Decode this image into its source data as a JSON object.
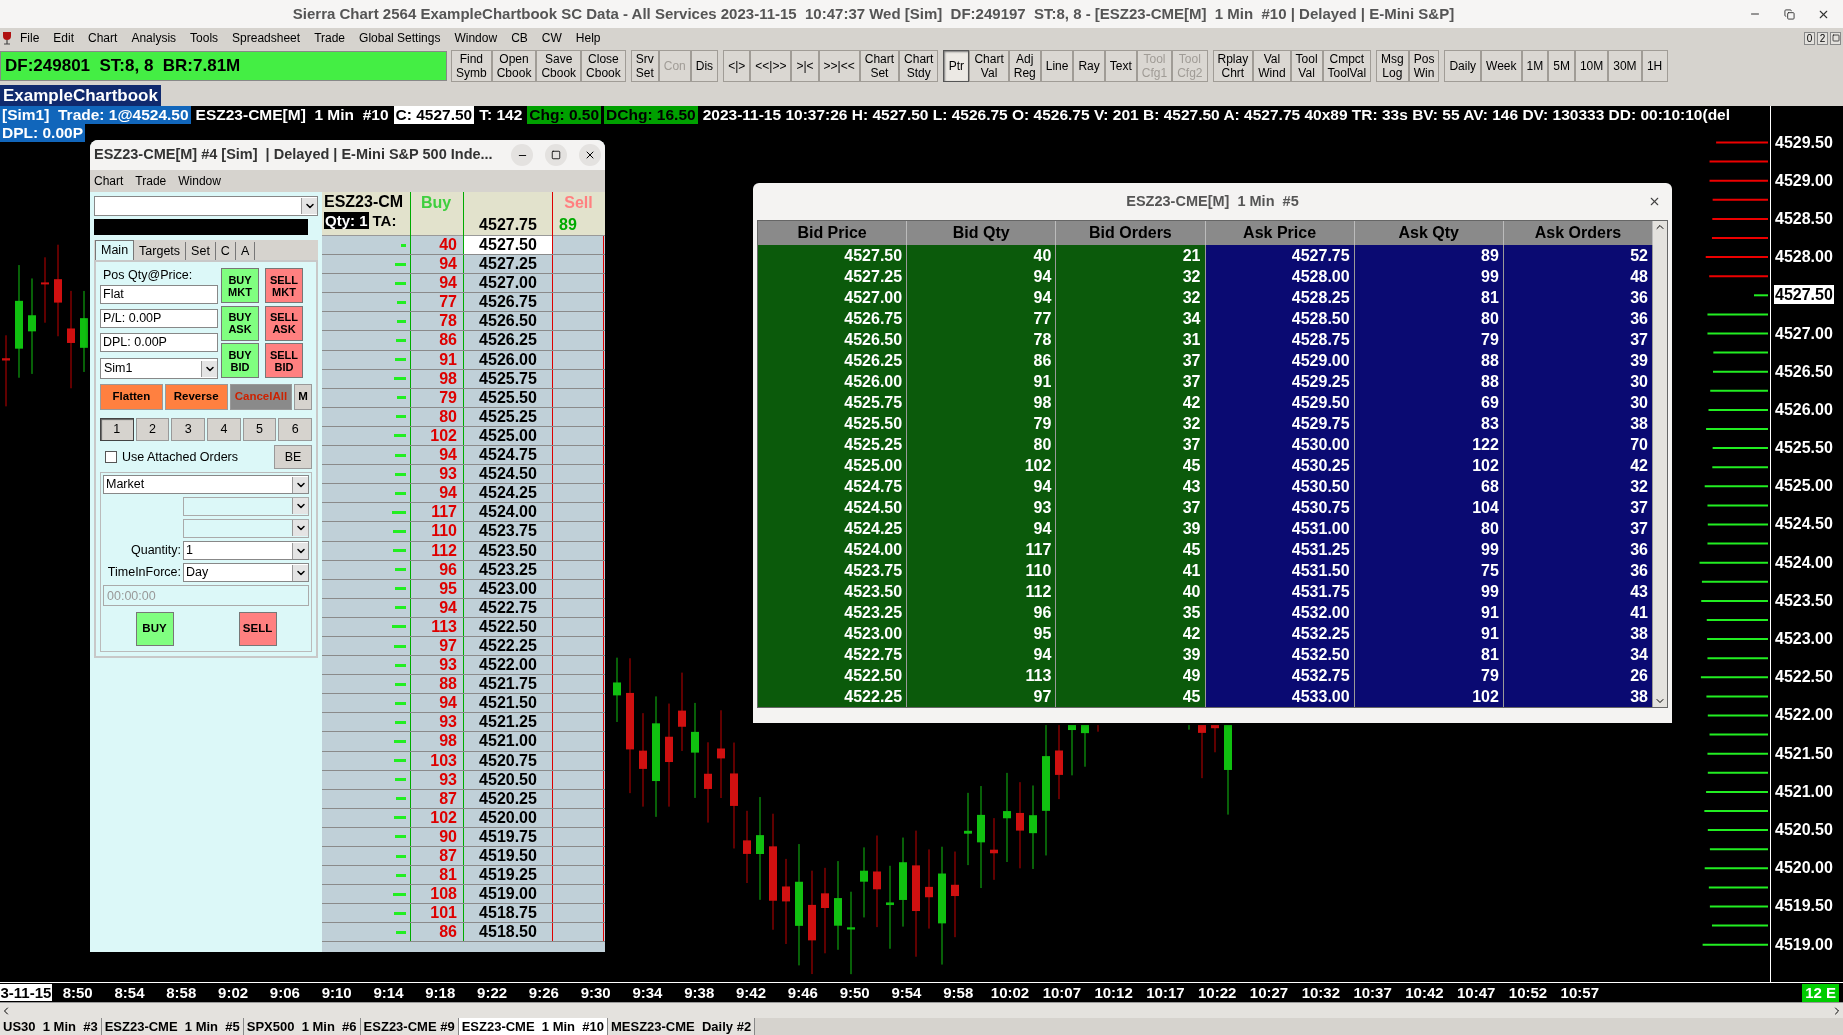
{
  "window": {
    "title": "Sierra Chart 2564 ExampleChartbook SC Data - All Services 2023-11-15  10:47:37 Wed [Sim]  DF:249197  ST:8, 8 - [ESZ23-CME[M]  1 Min  #10 | Delayed | E-Mini S&P]"
  },
  "menu": [
    "File",
    "Edit",
    "Chart",
    "Analysis",
    "Tools",
    "Spreadsheet",
    "Trade",
    "Global Settings",
    "Window",
    "CB",
    "CW",
    "Help"
  ],
  "corner_buttons": [
    "0",
    "2"
  ],
  "status": "DF:249801  ST:8, 8  BR:7.81M",
  "toolbar": [
    [
      {
        "lines": [
          "Find",
          "Symb"
        ],
        "disabled": false,
        "pressed": false
      },
      {
        "lines": [
          "Open",
          "Cbook"
        ],
        "disabled": false,
        "pressed": false
      },
      {
        "lines": [
          "Save",
          "Cbook"
        ],
        "disabled": false,
        "pressed": false
      },
      {
        "lines": [
          "Close",
          "Cbook"
        ],
        "disabled": false,
        "pressed": false
      }
    ],
    [
      {
        "lines": [
          "Srv",
          "Set"
        ],
        "disabled": false,
        "pressed": false
      },
      {
        "lines": [
          "Con"
        ],
        "disabled": true,
        "pressed": false
      },
      {
        "lines": [
          "Dis"
        ],
        "disabled": false,
        "pressed": false
      }
    ],
    [
      {
        "lines": [
          "<|>"
        ],
        "disabled": false,
        "pressed": false
      },
      {
        "lines": [
          "<<|>>"
        ],
        "disabled": false,
        "pressed": false
      },
      {
        "lines": [
          ">|<"
        ],
        "disabled": false,
        "pressed": false
      },
      {
        "lines": [
          ">>|<<"
        ],
        "disabled": false,
        "pressed": false
      },
      {
        "lines": [
          "Chart",
          "Set"
        ],
        "disabled": false,
        "pressed": false
      },
      {
        "lines": [
          "Chart",
          "Stdy"
        ],
        "disabled": false,
        "pressed": false
      }
    ],
    [
      {
        "lines": [
          "Ptr"
        ],
        "disabled": false,
        "pressed": true
      },
      {
        "lines": [
          "Chart",
          "Val"
        ],
        "disabled": false,
        "pressed": false
      },
      {
        "lines": [
          "Adj",
          "Reg"
        ],
        "disabled": false,
        "pressed": false
      },
      {
        "lines": [
          "Line"
        ],
        "disabled": false,
        "pressed": false
      },
      {
        "lines": [
          "Ray"
        ],
        "disabled": false,
        "pressed": false
      },
      {
        "lines": [
          "Text"
        ],
        "disabled": false,
        "pressed": false
      },
      {
        "lines": [
          "Tool",
          "Cfg1"
        ],
        "disabled": true,
        "pressed": false
      },
      {
        "lines": [
          "Tool",
          "Cfg2"
        ],
        "disabled": true,
        "pressed": false
      }
    ],
    [
      {
        "lines": [
          "Rplay",
          "Chrt"
        ],
        "disabled": false,
        "pressed": false
      },
      {
        "lines": [
          "Val",
          "Wind"
        ],
        "disabled": false,
        "pressed": false
      },
      {
        "lines": [
          "Tool",
          "Val"
        ],
        "disabled": false,
        "pressed": false
      },
      {
        "lines": [
          "Cmpct",
          "ToolVal"
        ],
        "disabled": false,
        "pressed": false
      }
    ],
    [
      {
        "lines": [
          "Msg",
          "Log"
        ],
        "disabled": false,
        "pressed": false
      },
      {
        "lines": [
          "Pos",
          "Win"
        ],
        "disabled": false,
        "pressed": false
      }
    ],
    [
      {
        "lines": [
          "Daily"
        ],
        "disabled": false,
        "pressed": false
      },
      {
        "lines": [
          "Week"
        ],
        "disabled": false,
        "pressed": false
      },
      {
        "lines": [
          "1M"
        ],
        "disabled": false,
        "pressed": false
      },
      {
        "lines": [
          "5M"
        ],
        "disabled": false,
        "pressed": false
      },
      {
        "lines": [
          "10M"
        ],
        "disabled": false,
        "pressed": false
      },
      {
        "lines": [
          "30M"
        ],
        "disabled": false,
        "pressed": false
      },
      {
        "lines": [
          "1H"
        ],
        "disabled": false,
        "pressed": false
      }
    ]
  ],
  "chartbook_tab": "ExampleChartbook",
  "info_line": [
    {
      "text": "[Sim1]  Trade: 1@4524.50",
      "kind": "account"
    },
    {
      "text": "ESZ23-CME[M]  1 Min  #10",
      "kind": "plain"
    },
    {
      "text": "C: 4527.50",
      "kind": "inverse"
    },
    {
      "text": "T: 142",
      "kind": "plain"
    },
    {
      "text": "Chg: 0.50",
      "kind": "positive"
    },
    {
      "text": "DChg: 16.50",
      "kind": "positive"
    },
    {
      "text": "2023-11-15 10:37:26 H: 4527.50 L: 4526.75 O: 4526.75 V: 201 B: 4527.50 A: 4527.75 40x89 TR: 33s BV: 55 AV: 146 DV: 130333 DD: 00:10:10(del",
      "kind": "plain"
    }
  ],
  "info_line_2": [
    {
      "text": "DPL: 0.00P",
      "kind": "account"
    }
  ],
  "price_axis": [
    {
      "text": "4529.50",
      "highlighted": false
    },
    {
      "text": "4529.00",
      "highlighted": false
    },
    {
      "text": "4528.50",
      "highlighted": false
    },
    {
      "text": "4528.00",
      "highlighted": false
    },
    {
      "text": "4527.50",
      "highlighted": true
    },
    {
      "text": "4527.00",
      "highlighted": false
    },
    {
      "text": "4526.50",
      "highlighted": false
    },
    {
      "text": "4526.00",
      "highlighted": false
    },
    {
      "text": "4525.50",
      "highlighted": false
    },
    {
      "text": "4525.00",
      "highlighted": false
    },
    {
      "text": "4524.50",
      "highlighted": false
    },
    {
      "text": "4524.00",
      "highlighted": false
    },
    {
      "text": "4523.50",
      "highlighted": false
    },
    {
      "text": "4523.00",
      "highlighted": false
    },
    {
      "text": "4522.50",
      "highlighted": false
    },
    {
      "text": "4522.00",
      "highlighted": false
    },
    {
      "text": "4521.50",
      "highlighted": false
    },
    {
      "text": "4521.00",
      "highlighted": false
    },
    {
      "text": "4520.50",
      "highlighted": false
    },
    {
      "text": "4520.00",
      "highlighted": false
    },
    {
      "text": "4519.50",
      "highlighted": false
    },
    {
      "text": "4519.00",
      "highlighted": false
    }
  ],
  "time_axis": [
    {
      "text": "3-11-15",
      "highlighted": true
    },
    {
      "text": "8:50",
      "highlighted": false
    },
    {
      "text": "8:54",
      "highlighted": false
    },
    {
      "text": "8:58",
      "highlighted": false
    },
    {
      "text": "9:02",
      "highlighted": false
    },
    {
      "text": "9:06",
      "highlighted": false
    },
    {
      "text": "9:10",
      "highlighted": false
    },
    {
      "text": "9:14",
      "highlighted": false
    },
    {
      "text": "9:18",
      "highlighted": false
    },
    {
      "text": "9:22",
      "highlighted": false
    },
    {
      "text": "9:26",
      "highlighted": false
    },
    {
      "text": "9:30",
      "highlighted": false
    },
    {
      "text": "9:34",
      "highlighted": false
    },
    {
      "text": "9:38",
      "highlighted": false
    },
    {
      "text": "9:42",
      "highlighted": false
    },
    {
      "text": "9:46",
      "highlighted": false
    },
    {
      "text": "9:50",
      "highlighted": false
    },
    {
      "text": "9:54",
      "highlighted": false
    },
    {
      "text": "9:58",
      "highlighted": false
    },
    {
      "text": "10:02",
      "highlighted": false
    },
    {
      "text": "10:07",
      "highlighted": false
    },
    {
      "text": "10:12",
      "highlighted": false
    },
    {
      "text": "10:17",
      "highlighted": false
    },
    {
      "text": "10:22",
      "highlighted": false
    },
    {
      "text": "10:27",
      "highlighted": false
    },
    {
      "text": "10:32",
      "highlighted": false
    },
    {
      "text": "10:37",
      "highlighted": false
    },
    {
      "text": "10:42",
      "highlighted": false
    },
    {
      "text": "10:47",
      "highlighted": false
    },
    {
      "text": "10:52",
      "highlighted": false
    },
    {
      "text": "10:57",
      "highlighted": false
    }
  ],
  "axis_badge": "12 E",
  "chartbook_tabs": [
    {
      "label": "US30  1 Min  #3",
      "selected": false
    },
    {
      "label": "ESZ23-CME  1 Min  #5",
      "selected": false
    },
    {
      "label": "SPX500  1 Min  #6",
      "selected": false
    },
    {
      "label": "ESZ23-CME #9",
      "selected": false
    },
    {
      "label": "ESZ23-CME  1 Min  #10",
      "selected": true
    },
    {
      "label": "MESZ23-CME  Daily #2",
      "selected": false
    }
  ],
  "trade_window": {
    "title": "ESZ23-CME[M] #4 [Sim]  | Delayed | E-Mini S&P 500 Inde...",
    "menu": [
      "Chart",
      "Trade",
      "Window"
    ],
    "tabs": [
      {
        "label": "Main",
        "selected": true
      },
      {
        "label": "Targets",
        "selected": false
      },
      {
        "label": "Set",
        "selected": false
      },
      {
        "label": "C",
        "selected": false
      },
      {
        "label": "A",
        "selected": false
      }
    ],
    "position_label": "Pos Qty@Price:",
    "position": "Flat",
    "pl": "P/L: 0.00P",
    "dpl": "DPL: 0.00P",
    "account": "Sim1",
    "order_buttons": [
      {
        "lines": [
          "BUY",
          "MKT"
        ],
        "kind": "buy"
      },
      {
        "lines": [
          "SELL",
          "MKT"
        ],
        "kind": "sell"
      },
      {
        "lines": [
          "BUY",
          "ASK"
        ],
        "kind": "buy"
      },
      {
        "lines": [
          "SELL",
          "ASK"
        ],
        "kind": "sell"
      },
      {
        "lines": [
          "BUY",
          "BID"
        ],
        "kind": "buy"
      },
      {
        "lines": [
          "SELL",
          "BID"
        ],
        "kind": "sell"
      }
    ],
    "action_buttons": [
      {
        "label": "Flatten",
        "kind": "orange"
      },
      {
        "label": "Reverse",
        "kind": "orange"
      },
      {
        "label": "CancelAll",
        "kind": "cancel"
      },
      {
        "label": "M",
        "kind": "plain"
      }
    ],
    "qty_presets": [
      {
        "label": "1",
        "selected": true
      },
      {
        "label": "2",
        "selected": false
      },
      {
        "label": "3",
        "selected": false
      },
      {
        "label": "4",
        "selected": false
      },
      {
        "label": "5",
        "selected": false
      },
      {
        "label": "6",
        "selected": false
      }
    ],
    "attached_orders": {
      "label": "Use Attached Orders",
      "checked": false
    },
    "be_button": "BE",
    "order_type": "Market",
    "quantity_label": "Quantity:",
    "quantity": "1",
    "tif_label": "TimeInForce:",
    "tif": "Day",
    "time_placeholder": "00:00:00",
    "buy": "BUY",
    "sell": "SELL"
  },
  "dom": {
    "symbol": "ESZ23-CM",
    "qty": "Qty: 1",
    "ta": "TA:",
    "buy_header": "Buy",
    "sell_header": "Sell",
    "ask_price": "4527.75",
    "ask_qty": "89",
    "rows": [
      {
        "bid": "40",
        "price": "4527.50",
        "highlighted": true
      },
      {
        "bid": "94",
        "price": "4527.25",
        "highlighted": false
      },
      {
        "bid": "94",
        "price": "4527.00",
        "highlighted": false
      },
      {
        "bid": "77",
        "price": "4526.75",
        "highlighted": false
      },
      {
        "bid": "78",
        "price": "4526.50",
        "highlighted": false
      },
      {
        "bid": "86",
        "price": "4526.25",
        "highlighted": false
      },
      {
        "bid": "91",
        "price": "4526.00",
        "highlighted": false
      },
      {
        "bid": "98",
        "price": "4525.75",
        "highlighted": false
      },
      {
        "bid": "79",
        "price": "4525.50",
        "highlighted": false
      },
      {
        "bid": "80",
        "price": "4525.25",
        "highlighted": false
      },
      {
        "bid": "102",
        "price": "4525.00",
        "highlighted": false
      },
      {
        "bid": "94",
        "price": "4524.75",
        "highlighted": false
      },
      {
        "bid": "93",
        "price": "4524.50",
        "highlighted": false
      },
      {
        "bid": "94",
        "price": "4524.25",
        "highlighted": false
      },
      {
        "bid": "117",
        "price": "4524.00",
        "highlighted": false
      },
      {
        "bid": "110",
        "price": "4523.75",
        "highlighted": false
      },
      {
        "bid": "112",
        "price": "4523.50",
        "highlighted": false
      },
      {
        "bid": "96",
        "price": "4523.25",
        "highlighted": false
      },
      {
        "bid": "95",
        "price": "4523.00",
        "highlighted": false
      },
      {
        "bid": "94",
        "price": "4522.75",
        "highlighted": false
      },
      {
        "bid": "113",
        "price": "4522.50",
        "highlighted": false
      },
      {
        "bid": "97",
        "price": "4522.25",
        "highlighted": false
      },
      {
        "bid": "93",
        "price": "4522.00",
        "highlighted": false
      },
      {
        "bid": "88",
        "price": "4521.75",
        "highlighted": false
      },
      {
        "bid": "94",
        "price": "4521.50",
        "highlighted": false
      },
      {
        "bid": "93",
        "price": "4521.25",
        "highlighted": false
      },
      {
        "bid": "98",
        "price": "4521.00",
        "highlighted": false
      },
      {
        "bid": "103",
        "price": "4520.75",
        "highlighted": false
      },
      {
        "bid": "93",
        "price": "4520.50",
        "highlighted": false
      },
      {
        "bid": "87",
        "price": "4520.25",
        "highlighted": false
      },
      {
        "bid": "102",
        "price": "4520.00",
        "highlighted": false
      },
      {
        "bid": "90",
        "price": "4519.75",
        "highlighted": false
      },
      {
        "bid": "87",
        "price": "4519.50",
        "highlighted": false
      },
      {
        "bid": "81",
        "price": "4519.25",
        "highlighted": false
      },
      {
        "bid": "108",
        "price": "4519.00",
        "highlighted": false
      },
      {
        "bid": "101",
        "price": "4518.75",
        "highlighted": false
      },
      {
        "bid": "86",
        "price": "4518.50",
        "highlighted": false
      }
    ]
  },
  "depth_window": {
    "title": "ESZ23-CME[M]  1 Min  #5",
    "columns": [
      "Bid Price",
      "Bid Qty",
      "Bid Orders",
      "Ask Price",
      "Ask Qty",
      "Ask Orders"
    ],
    "rows": [
      [
        "4527.50",
        "40",
        "21",
        "4527.75",
        "89",
        "52"
      ],
      [
        "4527.25",
        "94",
        "32",
        "4528.00",
        "99",
        "48"
      ],
      [
        "4527.00",
        "94",
        "32",
        "4528.25",
        "81",
        "36"
      ],
      [
        "4526.75",
        "77",
        "34",
        "4528.50",
        "80",
        "36"
      ],
      [
        "4526.50",
        "78",
        "31",
        "4528.75",
        "79",
        "37"
      ],
      [
        "4526.25",
        "86",
        "37",
        "4529.00",
        "88",
        "39"
      ],
      [
        "4526.00",
        "91",
        "37",
        "4529.25",
        "88",
        "30"
      ],
      [
        "4525.75",
        "98",
        "42",
        "4529.50",
        "69",
        "30"
      ],
      [
        "4525.50",
        "79",
        "32",
        "4529.75",
        "83",
        "38"
      ],
      [
        "4525.25",
        "80",
        "37",
        "4530.00",
        "122",
        "70"
      ],
      [
        "4525.00",
        "102",
        "45",
        "4530.25",
        "102",
        "42"
      ],
      [
        "4524.75",
        "94",
        "43",
        "4530.50",
        "68",
        "32"
      ],
      [
        "4524.50",
        "93",
        "37",
        "4530.75",
        "104",
        "37"
      ],
      [
        "4524.25",
        "94",
        "39",
        "4531.00",
        "80",
        "37"
      ],
      [
        "4524.00",
        "117",
        "45",
        "4531.25",
        "99",
        "36"
      ],
      [
        "4523.75",
        "110",
        "41",
        "4531.50",
        "75",
        "36"
      ],
      [
        "4523.50",
        "112",
        "40",
        "4531.75",
        "99",
        "43"
      ],
      [
        "4523.25",
        "96",
        "35",
        "4532.00",
        "91",
        "41"
      ],
      [
        "4523.00",
        "95",
        "42",
        "4532.25",
        "91",
        "38"
      ],
      [
        "4522.75",
        "94",
        "39",
        "4532.50",
        "81",
        "34"
      ],
      [
        "4522.50",
        "113",
        "49",
        "4532.75",
        "79",
        "26"
      ],
      [
        "4522.25",
        "97",
        "45",
        "4533.00",
        "102",
        "38"
      ]
    ]
  }
}
